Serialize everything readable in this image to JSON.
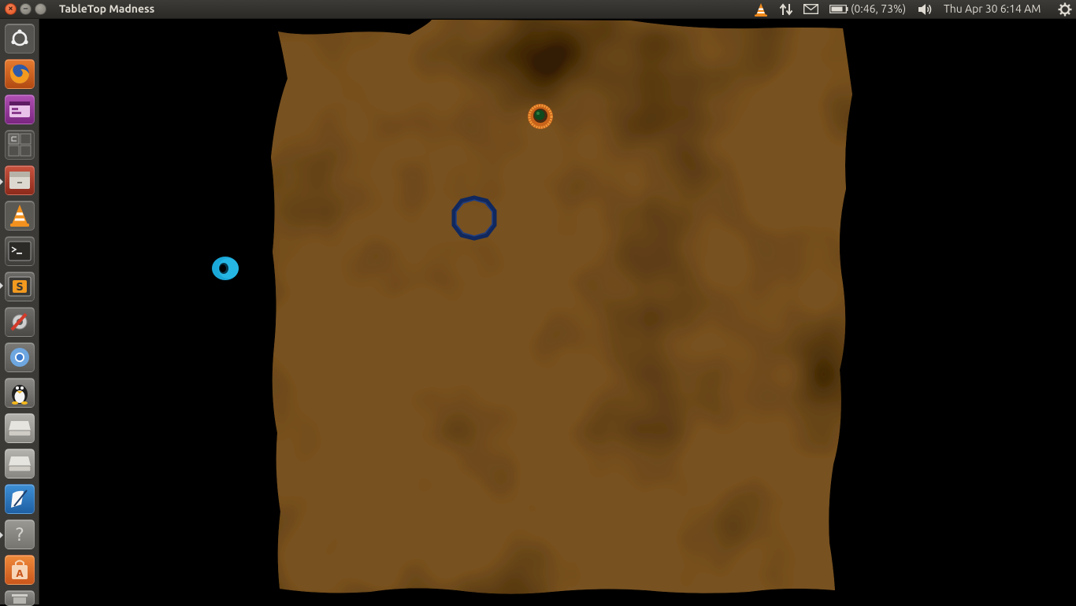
{
  "window": {
    "title": "TableTop Madness"
  },
  "panel": {
    "battery_text": "(0:46, 73%)",
    "clock_text": "Thu Apr 30  6:14 AM",
    "indicators": [
      "vlc-icon",
      "network-arrows-icon",
      "mail-icon",
      "battery-icon",
      "volume-icon",
      "gear-session-icon"
    ]
  },
  "launcher": {
    "items": [
      {
        "name": "dash-home",
        "icon": "ubuntu-logo-icon"
      },
      {
        "name": "firefox",
        "icon": "firefox-icon"
      },
      {
        "name": "unity-webapps",
        "icon": "purple-app-icon"
      },
      {
        "name": "workspace-switcher",
        "icon": "workspace-grid-icon"
      },
      {
        "name": "archive-manager",
        "icon": "file-cabinet-icon"
      },
      {
        "name": "vlc",
        "icon": "vlc-cone-icon"
      },
      {
        "name": "terminal",
        "icon": "terminal-icon"
      },
      {
        "name": "sublime-text",
        "icon": "sublime-icon"
      },
      {
        "name": "system-settings",
        "icon": "settings-icon"
      },
      {
        "name": "chromium",
        "icon": "chromium-icon"
      },
      {
        "name": "pidgin-tux",
        "icon": "tux-penguin-icon"
      },
      {
        "name": "drive-1",
        "icon": "hard-drive-icon"
      },
      {
        "name": "drive-2",
        "icon": "hard-drive-icon"
      },
      {
        "name": "text-editor",
        "icon": "edit-icon"
      },
      {
        "name": "help",
        "icon": "question-icon"
      },
      {
        "name": "software-center",
        "icon": "shopping-bag-icon"
      },
      {
        "name": "trash",
        "icon": "trash-icon"
      }
    ]
  },
  "game": {
    "board_colors": {
      "base": "#6f4a20",
      "dark": "#3d250c",
      "light": "#8a5e2b"
    },
    "pieces": [
      {
        "name": "player-token-orange",
        "color": "#e8801c",
        "inner": "#0f4a1e"
      },
      {
        "name": "target-ring-navy",
        "color": "#10285e"
      },
      {
        "name": "ring-cyan",
        "color": "#1aa8d8"
      }
    ]
  }
}
